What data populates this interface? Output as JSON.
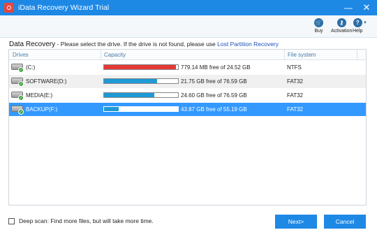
{
  "window": {
    "title": "iData Recovery Wizard Trial",
    "minimize_glyph": "—",
    "close_glyph": "✕",
    "accent": "#1e88e5"
  },
  "toolbar": {
    "buy": {
      "label": "Buy",
      "icon": "cart-icon",
      "glyph": "🛒"
    },
    "activation": {
      "label": "Activation",
      "icon": "key-icon",
      "glyph": "⚷"
    },
    "help": {
      "label": "Help",
      "icon": "question-icon",
      "glyph": "?"
    }
  },
  "instruction": {
    "heading": "Data Recovery",
    "text": " - Please select the drive. If the drive is not found, please use ",
    "link": "Lost Partition Recovery"
  },
  "table": {
    "columns": [
      "Drives",
      "Capacity",
      "File system"
    ],
    "rows": [
      {
        "name": "(C:)",
        "capacity": "779.14 MB free of 24.52 GB",
        "fs": "NTFS",
        "used_fraction": 0.97,
        "bar_color": "#e53935",
        "selected": false
      },
      {
        "name": "SOFTWARE(D:)",
        "capacity": "21.75 GB free of 76.59 GB",
        "fs": "FAT32",
        "used_fraction": 0.72,
        "bar_color": "#1e9ad6",
        "selected": false
      },
      {
        "name": "MEDIA(E:)",
        "capacity": "24.60 GB free of 76.59 GB",
        "fs": "FAT32",
        "used_fraction": 0.68,
        "bar_color": "#1e9ad6",
        "selected": false
      },
      {
        "name": "BACKUP(F:)",
        "capacity": "43.87 GB free of 55.19 GB",
        "fs": "FAT32",
        "used_fraction": 0.2,
        "bar_color": "#1e9ad6",
        "selected": true
      }
    ]
  },
  "deep_scan": {
    "label": "Deep scan: Find more files, but will take more time.",
    "checked": false
  },
  "buttons": {
    "next": "Next>",
    "cancel": "Cancel"
  }
}
